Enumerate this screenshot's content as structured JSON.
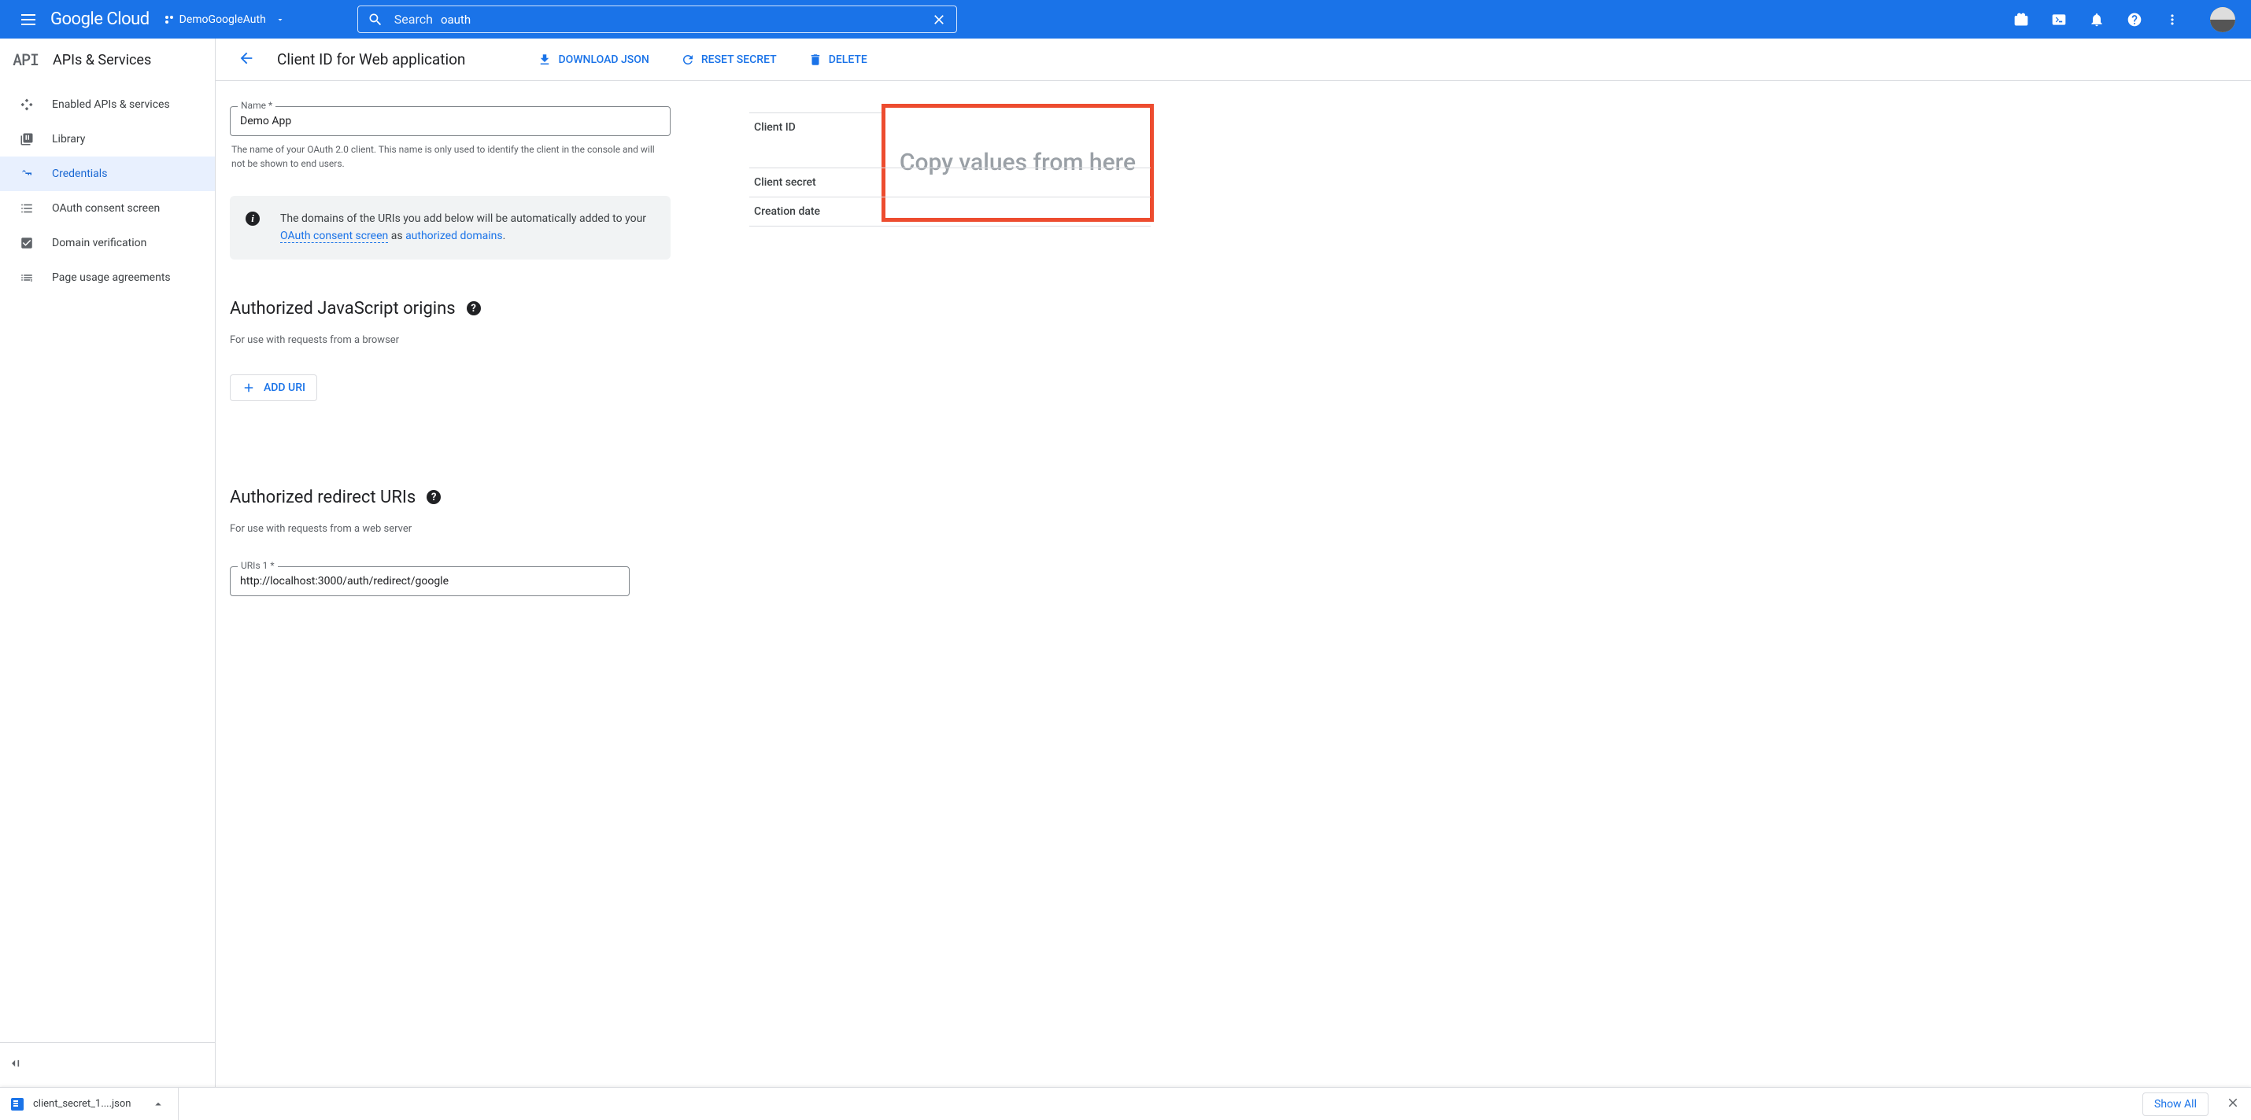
{
  "header": {
    "logo_text": "Google Cloud",
    "project_name": "DemoGoogleAuth",
    "search_label": "Search",
    "search_value": "oauth"
  },
  "sidebar": {
    "badge": "API",
    "title": "APIs & Services",
    "items": [
      {
        "label": "Enabled APIs & services",
        "icon": "diamond"
      },
      {
        "label": "Library",
        "icon": "library"
      },
      {
        "label": "Credentials",
        "icon": "key",
        "active": true
      },
      {
        "label": "OAuth consent screen",
        "icon": "consent"
      },
      {
        "label": "Domain verification",
        "icon": "check"
      },
      {
        "label": "Page usage agreements",
        "icon": "list"
      }
    ]
  },
  "actionbar": {
    "title": "Client ID for Web application",
    "download": "DOWNLOAD JSON",
    "reset": "RESET SECRET",
    "delete": "DELETE"
  },
  "form": {
    "name_label": "Name *",
    "name_value": "Demo App",
    "name_helper": "The name of your OAuth 2.0 client. This name is only used to identify the client in the console and will not be shown to end users.",
    "banner_pre": "The domains of the URIs you add below will be automatically added to your ",
    "banner_link1": "OAuth consent screen",
    "banner_mid": " as ",
    "banner_link2": "authorized domains",
    "banner_post": ".",
    "js_origins_heading": "Authorized JavaScript origins",
    "js_origins_sub": "For use with requests from a browser",
    "add_uri": "ADD URI",
    "redirect_heading": "Authorized redirect URIs",
    "redirect_sub": "For use with requests from a web server",
    "uri1_label": "URIs 1 *",
    "uri1_value": "http://localhost:3000/auth/redirect/google"
  },
  "panel": {
    "client_id": "Client ID",
    "client_secret": "Client secret",
    "creation_date": "Creation date",
    "annotation": "Copy values from here"
  },
  "downloadbar": {
    "file_name": "client_secret_1....json",
    "show_all": "Show All"
  }
}
